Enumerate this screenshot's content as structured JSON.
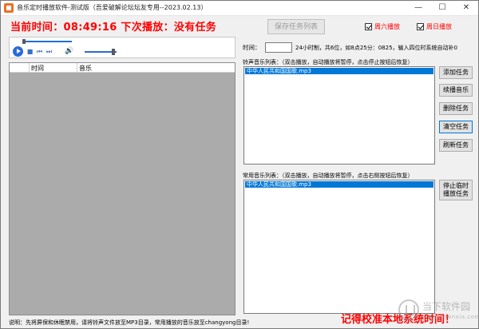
{
  "window": {
    "title": "音乐定时播放软件-测试版（吾爱破解论坛坛友专用--2023.02.13）",
    "minimize": "—",
    "maximize": "☐",
    "close": "✕"
  },
  "header": {
    "now_time": "当前时间：08:49:16  下次播放：没有任务",
    "save_task_list": "保存任务列表",
    "checkbox_saturday": "周六播放",
    "checkbox_sunday": "周日播放",
    "saturday_checked": true,
    "sunday_checked": true
  },
  "player": {
    "seek_progress": 0.0,
    "volume_level": 0.85
  },
  "playlist": {
    "col_time": "时间",
    "col_music": "音乐"
  },
  "time_setting": {
    "label": "时间：",
    "value": "",
    "hint": "24小时制，共6位，如8点25分：0825，输入四位时系统自动补0"
  },
  "ring_list": {
    "label": "铃声音乐列表：（双击播放，自动播放将暂停，点击停止按钮后恢复）",
    "items": [
      "中华人民共和国国歌.mp3"
    ]
  },
  "buttons": {
    "add_task": "添加任务",
    "resume_music": "续播音乐",
    "delete_task": "删除任务",
    "clear_task": "清空任务",
    "refresh_task": "刷新任务",
    "stop_temp": "停止临时播放任务"
  },
  "common_list": {
    "label": "常用音乐列表：（双击播放，自动播放将暂停，点击右侧按钮后恢复）",
    "items": [
      "中华人民共和国国歌.mp3"
    ]
  },
  "footer": {
    "note": "说明：先将屏保和休眠禁用，请将铃声文件放至MP3目录，常用播放的音乐放至changyong目录!",
    "calibrate": "记得校准本地系统时间！"
  },
  "watermark": {
    "title": "当下软件园",
    "url": "www.downxia.com"
  },
  "colors": {
    "alert_red": "#ff0000",
    "selection_blue": "#0078d7",
    "playlist_gray": "#ababab"
  }
}
